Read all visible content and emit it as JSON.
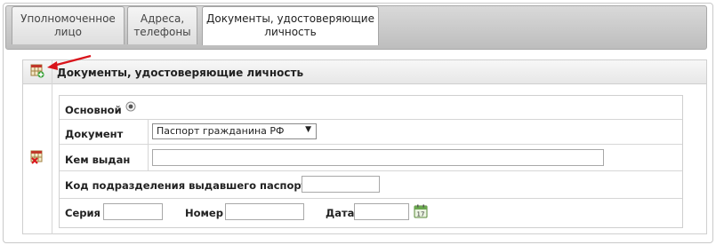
{
  "tabs": [
    {
      "label_line1": "Уполномоченное",
      "label_line2": "лицо"
    },
    {
      "label_line1": "Адреса,",
      "label_line2": "телефоны"
    },
    {
      "label_line1": "Документы, удостоверяющие",
      "label_line2": "личность"
    }
  ],
  "panel": {
    "title": "Документы, удостоверяющие личность",
    "add_icon": "add-row-icon",
    "delete_icon": "delete-row-icon"
  },
  "form": {
    "primary_label": "Основной",
    "document_label": "Документ",
    "document_value": "Паспорт гражданина РФ",
    "issued_by_label": "Кем выдан",
    "issued_by_value": "",
    "division_code_label": "Код подразделения выдавшего паспорт",
    "division_code_value": "",
    "series_label": "Серия",
    "series_value": "",
    "number_label": "Номер",
    "number_value": "",
    "date_label": "Дата",
    "date_value": "",
    "calendar_icon": "calendar-icon",
    "calendar_day": "17"
  },
  "colors": {
    "accent_arrow": "#d9141b",
    "tab_bar": "#c8c8c8"
  }
}
